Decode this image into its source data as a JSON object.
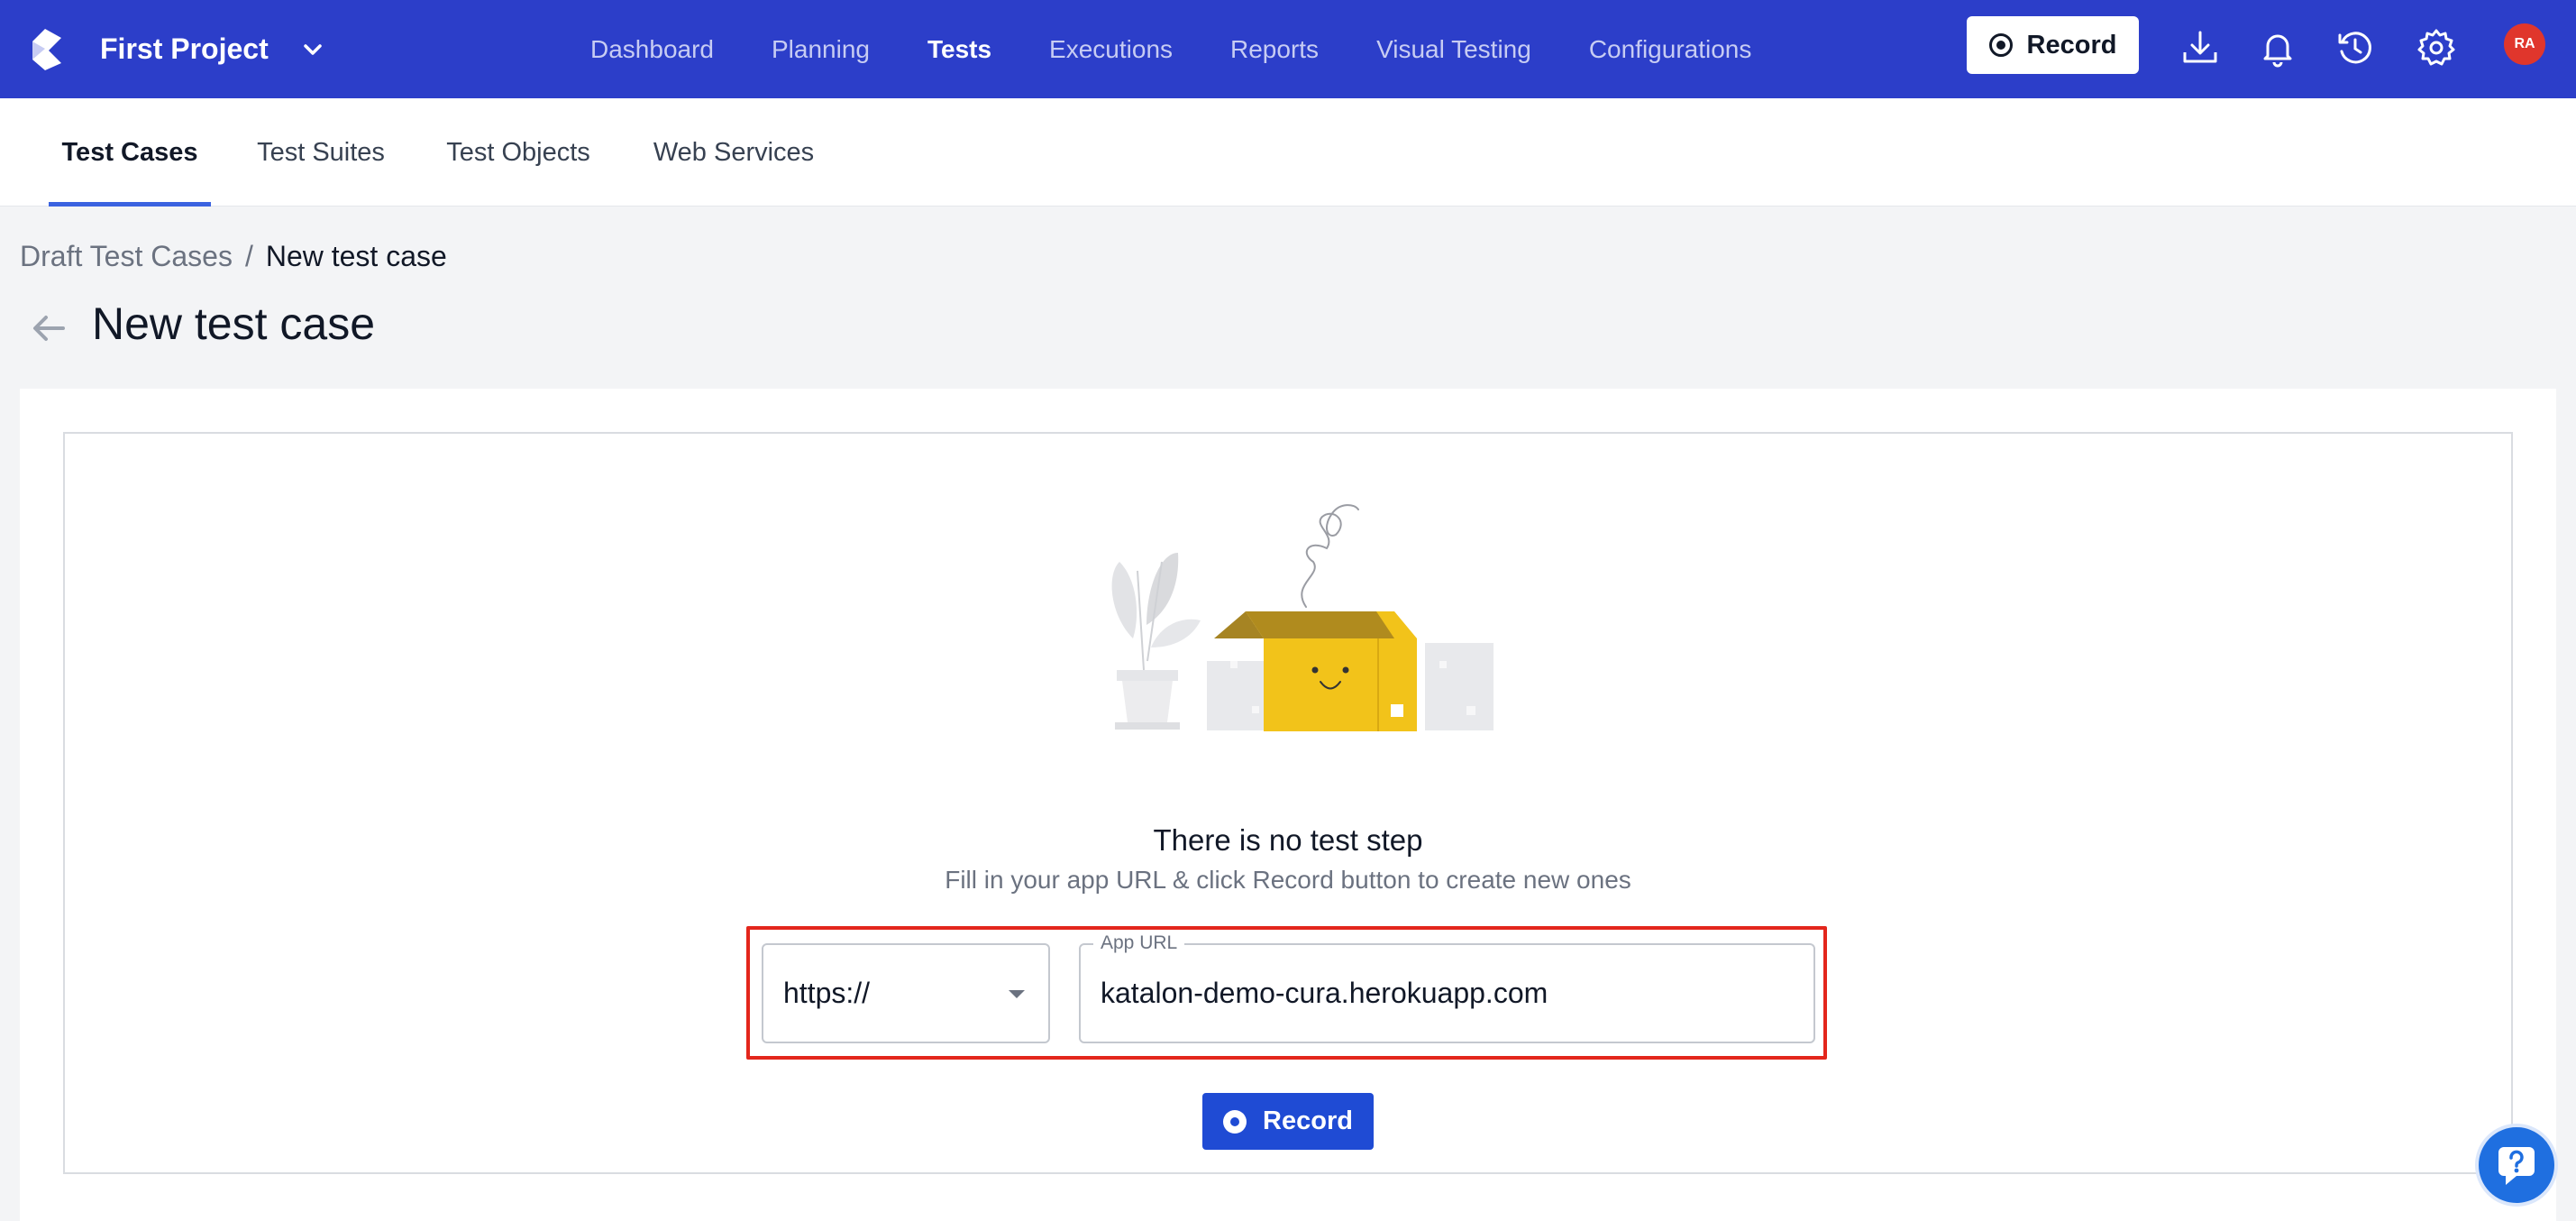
{
  "header": {
    "project_name": "First Project",
    "nav": [
      {
        "label": "Dashboard",
        "active": false
      },
      {
        "label": "Planning",
        "active": false
      },
      {
        "label": "Tests",
        "active": true
      },
      {
        "label": "Executions",
        "active": false
      },
      {
        "label": "Reports",
        "active": false
      },
      {
        "label": "Visual Testing",
        "active": false
      },
      {
        "label": "Configurations",
        "active": false
      }
    ],
    "record_label": "Record",
    "icons": [
      "download-icon",
      "bell-icon",
      "history-icon",
      "gear-icon"
    ],
    "avatar_initials": "RA",
    "colors": {
      "bar": "#2c3ec9",
      "avatar": "#e0362c"
    }
  },
  "subtabs": [
    {
      "label": "Test Cases",
      "active": true
    },
    {
      "label": "Test Suites",
      "active": false
    },
    {
      "label": "Test Objects",
      "active": false
    },
    {
      "label": "Web Services",
      "active": false
    }
  ],
  "breadcrumb": {
    "parent": "Draft Test Cases",
    "separator": "/",
    "current": "New test case"
  },
  "page": {
    "title": "New test case"
  },
  "empty_state": {
    "title": "There is no test step",
    "subtitle": "Fill in your app URL & click Record button to create new ones"
  },
  "form": {
    "protocol": "https://",
    "url_label": "App URL",
    "url_value": "katalon-demo-cura.herokuapp.com",
    "record_label": "Record",
    "highlight_color": "#e3261c"
  }
}
